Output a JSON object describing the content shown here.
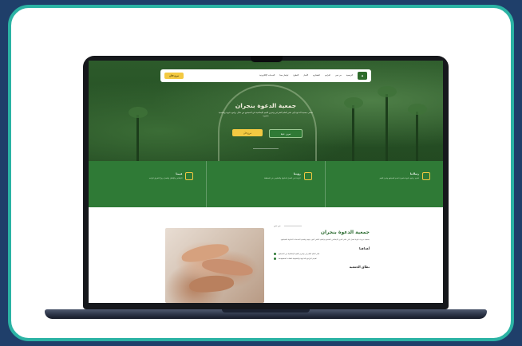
{
  "colors": {
    "frame": "#2bb3a4",
    "background": "#1f3f6a",
    "brand_green": "#2f7a36",
    "accent_yellow": "#f3c942"
  },
  "nav": {
    "items": [
      "الرئيسية",
      "من نحن",
      "البرامج",
      "المشاريع",
      "الأخبار",
      "التطوع",
      "تواصل معنا",
      "الخدمات الإلكترونية"
    ],
    "cta": "تبرع الآن"
  },
  "hero": {
    "title": "جمعية الدعوة بنجران",
    "description": "تسعى جمعية الدعوة إلى نشر العلم الشرعي وتعزيز القيم الإسلامية في المجتمع من خلال برامج دعوية وتعليمية متميزة",
    "primary_button": "تعرف علينا",
    "secondary_button": "تبرع الآن"
  },
  "features": [
    {
      "title": "رسالتنا",
      "desc": "تقديم برامج دعوية متميزة تخدم المجتمع وتعزز القيم"
    },
    {
      "title": "رؤيتنا",
      "desc": "الريادة في العمل الدعوي والتعليمي في المنطقة"
    },
    {
      "title": "قيمنا",
      "desc": "الإخلاص والإتقان والعمل بروح الفريق الواحد"
    }
  ],
  "about": {
    "tag": "من نحن",
    "title": "جمعية الدعوة بنجران",
    "description": "جمعية خيرية دعوية تعمل على نشر الدين الإسلامي الصحيح وتعليم الناس أمور دينهم وتقديم الخدمات الدعوية للمجتمع.",
    "goals_title": "أهدافنا",
    "goals": [
      "نشر العلم الشرعي وتعزيز القيم الإسلامية في المجتمع",
      "تقديم البرامج الدعوية والتعليمية للفئات المستهدفة"
    ],
    "scope_title": "نطاق الجمعية"
  }
}
